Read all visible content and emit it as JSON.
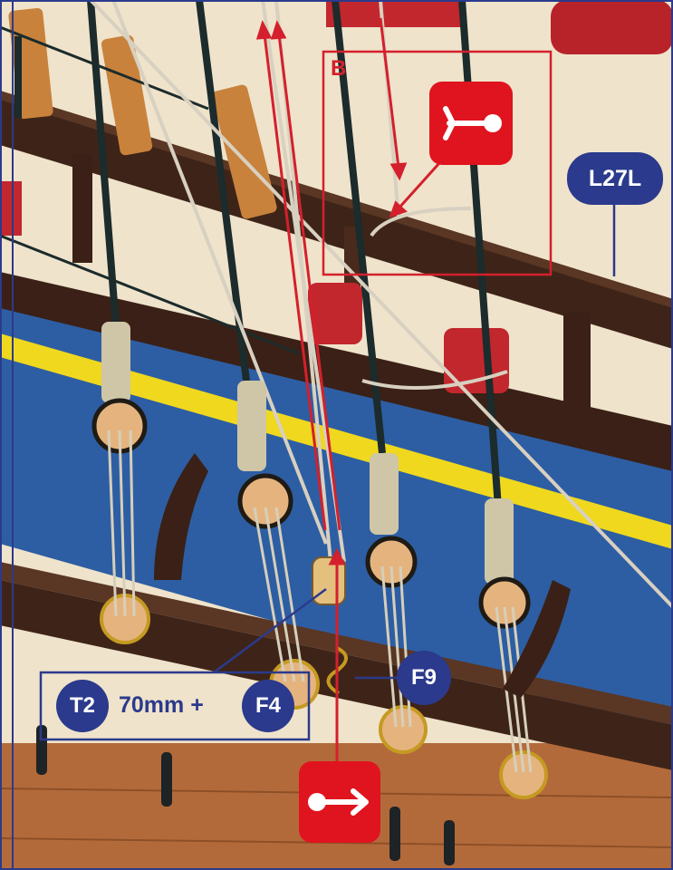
{
  "labels": {
    "detail_letter": "B",
    "part_l27l": "L27L",
    "part_f9": "F9",
    "part_t2": "T2",
    "length_text": "70mm +",
    "part_f4": "F4"
  },
  "icons": {
    "top": "belay-line-icon",
    "bottom": "line-direction-arrow-icon"
  },
  "colors": {
    "annotation_blue": "#2b3a8c",
    "annotation_red": "#d4202c",
    "icon_red": "#e0141e",
    "hull_blue": "#2d5ea3",
    "hull_stripe": "#f0d81e",
    "wood_dark": "#3e2418"
  }
}
